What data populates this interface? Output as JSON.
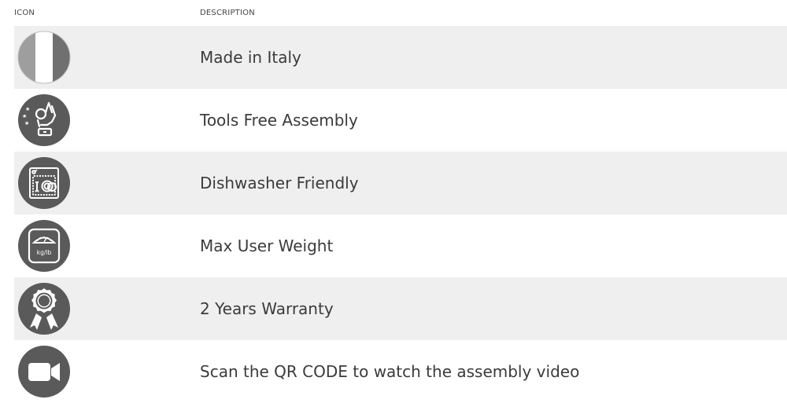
{
  "header": {
    "icon_label": "ICON",
    "description_label": "DESCRIPTION"
  },
  "rows": [
    {
      "icon": "italy-flag-icon",
      "description": "Made in Italy"
    },
    {
      "icon": "tools-free-hand-icon",
      "description": "Tools Free Assembly"
    },
    {
      "icon": "dishwasher-icon",
      "description": "Dishwasher Friendly"
    },
    {
      "icon": "weight-scale-icon",
      "description": "Max User Weight",
      "icon_text": "kg/lb"
    },
    {
      "icon": "warranty-rosette-icon",
      "description": "2 Years Warranty"
    },
    {
      "icon": "video-camera-icon",
      "description": "Scan the QR CODE to watch the assembly video"
    }
  ],
  "colors": {
    "icon_circle": "#5a5a5a",
    "row_shade": "#efefef",
    "text": "#3b3b3b"
  }
}
